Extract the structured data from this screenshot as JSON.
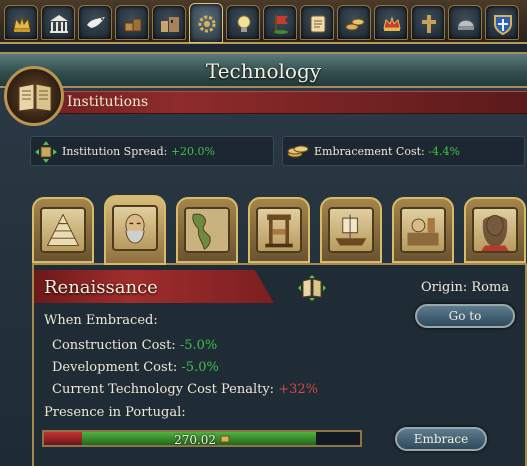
{
  "tabs": [
    {
      "icon": "crown-icon"
    },
    {
      "icon": "court-icon"
    },
    {
      "icon": "dove-icon"
    },
    {
      "icon": "trade-goods-icon"
    },
    {
      "icon": "buildings-icon"
    },
    {
      "icon": "technology-gears-icon",
      "active": true
    },
    {
      "icon": "idea-bulb-icon"
    },
    {
      "icon": "flag-icon"
    },
    {
      "icon": "scroll-icon"
    },
    {
      "icon": "coins-icon"
    },
    {
      "icon": "crown-ornament-icon"
    },
    {
      "icon": "cross-icon"
    },
    {
      "icon": "helmet-icon"
    },
    {
      "icon": "shield-icon"
    }
  ],
  "window": {
    "title": "Technology"
  },
  "institutions": {
    "header": "Institutions",
    "spread_label": "Institution Spread:",
    "spread_value": "+20.0%",
    "cost_label": "Embracement Cost:",
    "cost_value": "-4.4%"
  },
  "institution_tabs": [
    {
      "name": "feudalism-tab",
      "icon": "pyramid-icon"
    },
    {
      "name": "renaissance-tab",
      "icon": "leonardo-portrait-icon",
      "active": true
    },
    {
      "name": "new-world-tab",
      "icon": "americas-map-icon"
    },
    {
      "name": "printing-press-tab",
      "icon": "printing-press-icon"
    },
    {
      "name": "global-trade-tab",
      "icon": "ship-icon"
    },
    {
      "name": "manufactories-tab",
      "icon": "workshop-icon"
    },
    {
      "name": "enlightenment-tab",
      "icon": "noble-portrait-icon"
    }
  ],
  "detail": {
    "name": "Renaissance",
    "origin": "Origin: Roma",
    "goto_label": "Go to",
    "when_embraced": "When Embraced:",
    "construction_label": "Construction Cost:",
    "construction_value": "-5.0%",
    "development_label": "Development Cost:",
    "development_value": "-5.0%",
    "penalty_label": "Current Technology Cost Penalty:",
    "penalty_value": "+32%",
    "presence_label": "Presence in Portugal:",
    "presence_value": "270.02",
    "presence_red_fraction": 0.12,
    "presence_green_fraction": 0.74,
    "embrace_label": "Embrace"
  }
}
